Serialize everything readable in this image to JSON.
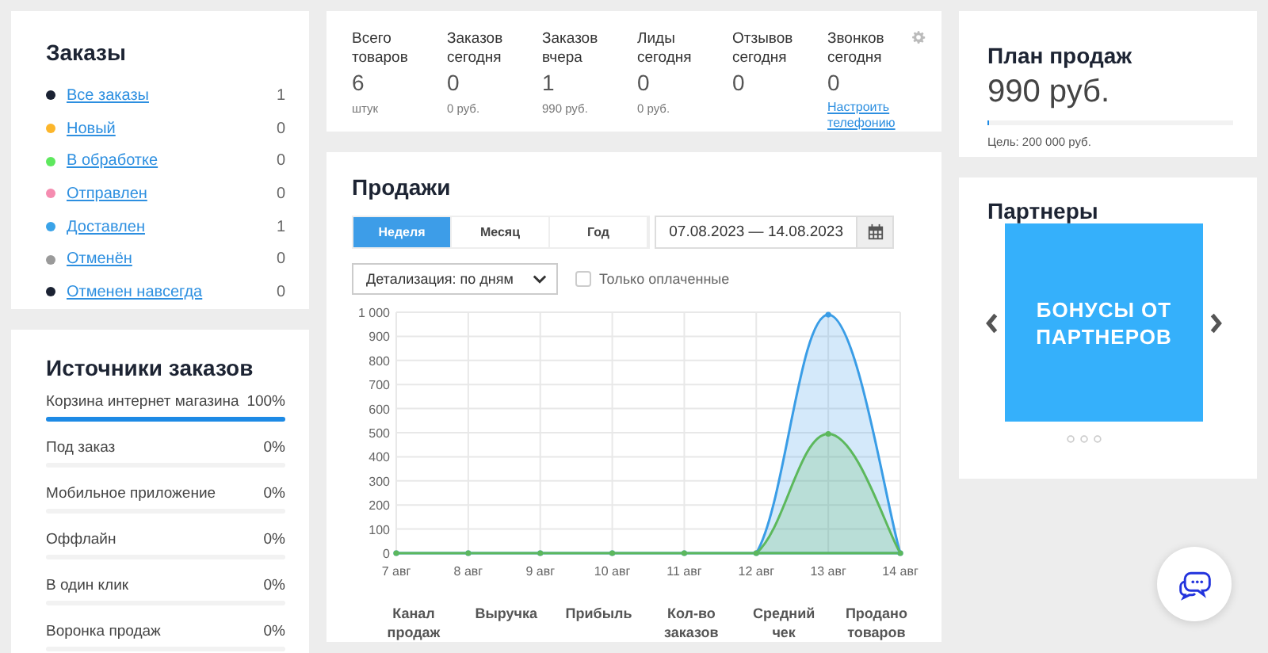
{
  "orders": {
    "title": "Заказы",
    "items": [
      {
        "name": "Все заказы",
        "count": "1",
        "color": "#1b2233"
      },
      {
        "name": "Новый",
        "count": "0",
        "color": "#fcb62b"
      },
      {
        "name": "В обработке",
        "count": "0",
        "color": "#5ee85e"
      },
      {
        "name": "Отправлен",
        "count": "0",
        "color": "#f58cb0"
      },
      {
        "name": "Доставлен",
        "count": "1",
        "color": "#3aa3e8"
      },
      {
        "name": "Отменён",
        "count": "0",
        "color": "#9a9a9a"
      },
      {
        "name": "Отменен навсегда",
        "count": "0",
        "color": "#1b2233"
      }
    ]
  },
  "sources": {
    "title": "Источники заказов",
    "items": [
      {
        "name": "Корзина интернет магазина",
        "percent": "100%",
        "level": 1
      },
      {
        "name": "Под заказ",
        "percent": "0%",
        "level": 0
      },
      {
        "name": "Мобильное приложение",
        "percent": "0%",
        "level": 0
      },
      {
        "name": "Оффлайн",
        "percent": "0%",
        "level": 0
      },
      {
        "name": "В один клик",
        "percent": "0%",
        "level": 0
      },
      {
        "name": "Воронка продаж",
        "percent": "0%",
        "level": 0
      }
    ]
  },
  "stats": [
    {
      "label": "Всего товаров",
      "value": "6",
      "note": "штук"
    },
    {
      "label": "Заказов сегодня",
      "value": "0",
      "note": "0 руб."
    },
    {
      "label": "Заказов вчера",
      "value": "1",
      "note": "990 руб."
    },
    {
      "label": "Лиды сегодня",
      "value": "0",
      "note": "0 руб."
    },
    {
      "label": "Отзывов сегодня",
      "value": "0"
    },
    {
      "label": "Звонков сегодня",
      "value": "0",
      "link": "Настроить телефонию"
    }
  ],
  "sales": {
    "title": "Продажи",
    "periods": [
      {
        "label": "Неделя",
        "selected": true
      },
      {
        "label": "Месяц",
        "selected": false
      },
      {
        "label": "Год",
        "selected": false
      }
    ],
    "date_range": "07.08.2023 — 14.08.2023",
    "detail_select": "Детализация: по дням",
    "paid_only": {
      "label": "Только оплаченные",
      "checked": false
    },
    "chart_data": {
      "type": "area",
      "grid": true,
      "categories": [
        "7 авг",
        "8 авг",
        "9 авг",
        "10 авг",
        "11 авг",
        "12 авг",
        "13 авг",
        "14 авг"
      ],
      "series": [
        {
          "color": "#3a9de6",
          "values": [
            0,
            0,
            0,
            0,
            0,
            0,
            990,
            0
          ]
        },
        {
          "color": "#5cb85c",
          "values": [
            0,
            0,
            0,
            0,
            0,
            0,
            495,
            0
          ]
        }
      ],
      "ylim": [
        0,
        1000
      ],
      "yticks": [
        {
          "value": 0,
          "label": "0"
        },
        {
          "value": 100,
          "label": "100"
        },
        {
          "value": 200,
          "label": "200"
        },
        {
          "value": 300,
          "label": "300"
        },
        {
          "value": 400,
          "label": "400"
        },
        {
          "value": 500,
          "label": "500"
        },
        {
          "value": 600,
          "label": "600"
        },
        {
          "value": 700,
          "label": "700"
        },
        {
          "value": 800,
          "label": "800"
        },
        {
          "value": 900,
          "label": "900"
        },
        {
          "value": 1000,
          "label": "1 000"
        }
      ]
    },
    "table_columns": [
      "Канал продаж",
      "Выручка",
      "Прибыль",
      "Кол-во заказов",
      "Средний чек",
      "Продано товаров"
    ]
  },
  "plan": {
    "title": "План продаж",
    "amount": "990 руб.",
    "level": 0.005,
    "goal": "Цель: 200 000 руб."
  },
  "partners": {
    "title": "Партнеры",
    "banner": "БОНУСЫ ОТ ПАРТНЕРОВ"
  }
}
